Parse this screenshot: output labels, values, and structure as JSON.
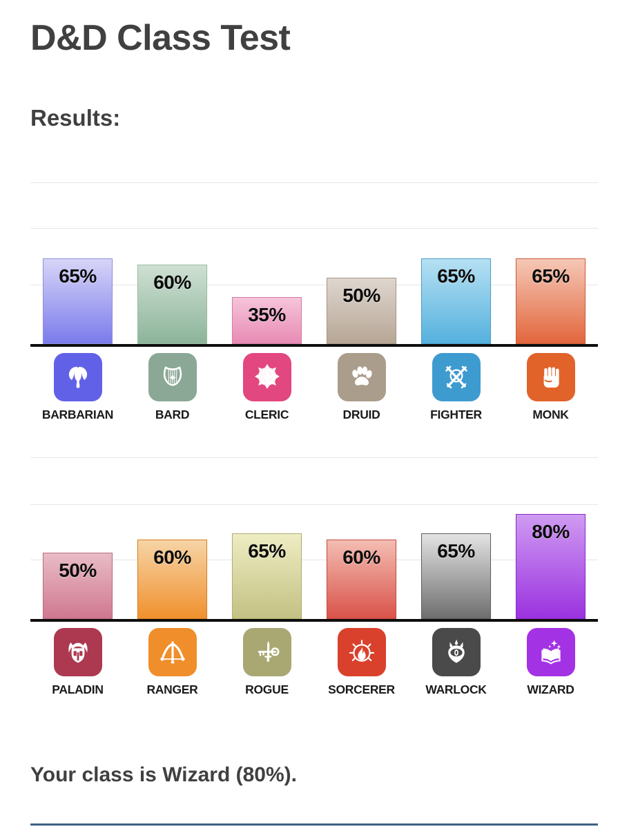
{
  "header": {
    "title": "D&D Class Test",
    "results_label": "Results:"
  },
  "footer": {
    "result_sentence": "Your class is Wizard (80%)."
  },
  "theme": {
    "text_color": "#404040",
    "baseline_color": "#0d0d0d",
    "gridline_color": "#e6e6e6",
    "bottom_rule_color": "#3f6184"
  },
  "chart_data": [
    {
      "type": "bar",
      "title": "Results:",
      "xlabel": "",
      "ylabel": "",
      "ylim": [
        0,
        100
      ],
      "grid": true,
      "legend": "none",
      "categories": [
        "BARBARIAN",
        "BARD",
        "CLERIC",
        "DRUID",
        "FIGHTER",
        "MONK"
      ],
      "values": [
        65,
        60,
        35,
        50,
        65,
        65
      ],
      "value_labels": [
        "65%",
        "60%",
        "35%",
        "50%",
        "65%",
        "65%"
      ],
      "bar_colors_top": [
        "#d7d5f7",
        "#cfe0d3",
        "#f6c4da",
        "#ded6cf",
        "#b6e0f3",
        "#f5c8b6"
      ],
      "bar_colors_bottom": [
        "#7b7bec",
        "#8cb49a",
        "#e88bb4",
        "#b7a695",
        "#55b1dd",
        "#e2663d"
      ],
      "bar_border_colors": [
        "#8f8fe2",
        "#9dbda6",
        "#d37da3",
        "#a79684",
        "#4c9ec6",
        "#cb5c37"
      ],
      "icon_tile_colors": [
        "#6161e8",
        "#8ba795",
        "#e2477f",
        "#ab9d8c",
        "#3e9bd0",
        "#e1632a"
      ],
      "icon_names": [
        "battle-axe-icon",
        "lyre-icon",
        "sunburst-cross-icon",
        "paw-print-icon",
        "crossed-swords-icon",
        "fist-icon"
      ]
    },
    {
      "type": "bar",
      "title": "",
      "xlabel": "",
      "ylabel": "",
      "ylim": [
        0,
        100
      ],
      "grid": true,
      "legend": "none",
      "categories": [
        "PALADIN",
        "RANGER",
        "ROGUE",
        "SORCERER",
        "WARLOCK",
        "WIZARD"
      ],
      "values": [
        50,
        60,
        65,
        60,
        65,
        80
      ],
      "value_labels": [
        "50%",
        "60%",
        "65%",
        "60%",
        "65%",
        "80%"
      ],
      "bar_colors_top": [
        "#e8bcc6",
        "#f7d4a6",
        "#eeedc3",
        "#f4bdb2",
        "#e3e3e3",
        "#cf9bf2"
      ],
      "bar_colors_bottom": [
        "#d0788f",
        "#f0912e",
        "#c3c183",
        "#d9534a",
        "#6e6e6e",
        "#9b32e0"
      ],
      "bar_border_colors": [
        "#bb6a80",
        "#d97f23",
        "#b0ae72",
        "#c44a41",
        "#5e5e5e",
        "#8a2ac9"
      ],
      "icon_tile_colors": [
        "#ac3950",
        "#ef8e2b",
        "#a9a873",
        "#d9412c",
        "#4a4a4a",
        "#a332e4"
      ],
      "icon_names": [
        "winged-helm-icon",
        "bow-and-arrow-icon",
        "dagger-key-icon",
        "flame-icon",
        "eye-icon",
        "spellbook-icon"
      ]
    }
  ]
}
